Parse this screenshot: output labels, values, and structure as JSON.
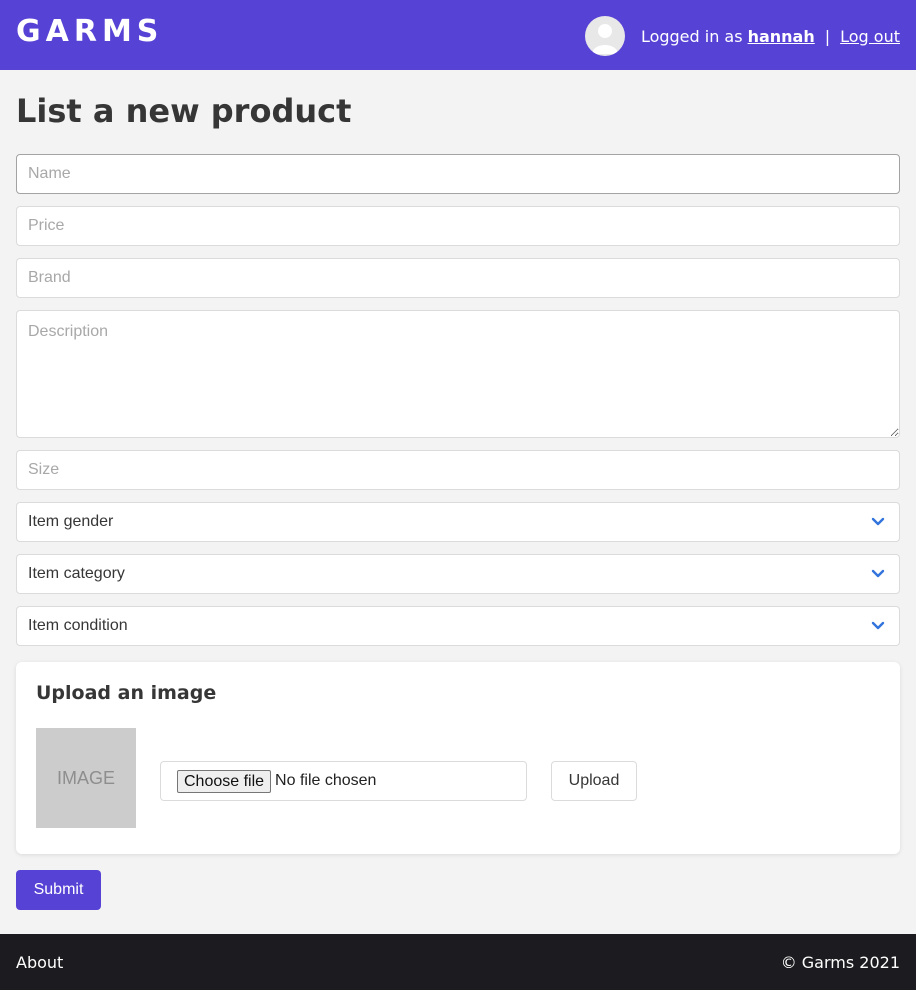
{
  "header": {
    "logo": "GARMS",
    "logged_in_prefix": "Logged in as",
    "username": "hannah",
    "separator": "|",
    "logout_label": "Log out",
    "brand_color": "#5742d6"
  },
  "main": {
    "title": "List a new product",
    "fields": {
      "name_placeholder": "Name",
      "price_placeholder": "Price",
      "brand_placeholder": "Brand",
      "description_placeholder": "Description",
      "size_placeholder": "Size"
    },
    "selects": {
      "gender": "Item gender",
      "category": "Item category",
      "condition": "Item condition"
    },
    "upload": {
      "title": "Upload an image",
      "image_placeholder": "IMAGE",
      "choose_file_label": "Choose file",
      "no_file_text": "No file chosen",
      "upload_label": "Upload"
    },
    "submit_label": "Submit"
  },
  "footer": {
    "about_label": "About",
    "copyright": "© Garms 2021",
    "background": "#1c1b1f"
  },
  "icons": [
    "avatar-user-icon",
    "chevron-down-icon"
  ]
}
